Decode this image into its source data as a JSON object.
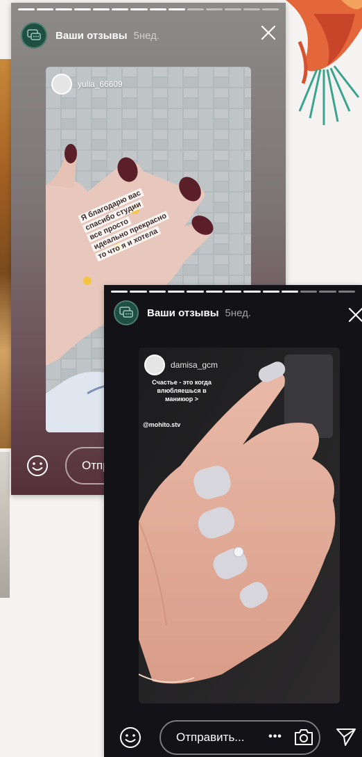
{
  "card1": {
    "title": "Ваши отзывы",
    "time": "5нед.",
    "repost": {
      "username": "yulia_66609",
      "caption_lines": [
        "Я благодарю вас",
        "спасибо студии",
        "все просто",
        "идеально прекрасно",
        "то что я и хотела"
      ]
    },
    "send_placeholder": "Отпр"
  },
  "card2": {
    "title": "Ваши отзывы",
    "time": "5нед.",
    "repost": {
      "username": "damisa_gcm",
      "caption": "Счастье - это когда влюбляешься в маникюр >",
      "mention": "@mohito.stv"
    },
    "send_placeholder": "Отправить...",
    "more_label": "•••"
  },
  "colors": {
    "accent_avatar": "#1f4f42",
    "card2_bg": "#121217"
  }
}
